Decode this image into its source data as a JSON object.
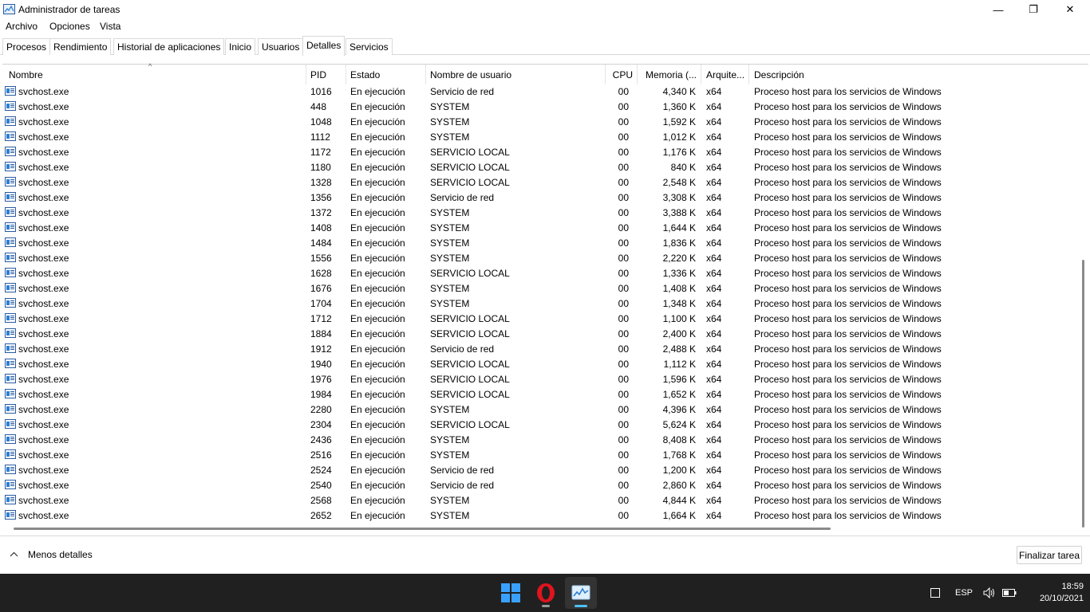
{
  "window": {
    "title": "Administrador de tareas",
    "minimize_glyph": "—",
    "maximize_glyph": "❐",
    "close_glyph": "✕"
  },
  "menu": [
    "Archivo",
    "Opciones",
    "Vista"
  ],
  "tabs": [
    {
      "label": "Procesos",
      "active": false
    },
    {
      "label": "Rendimiento",
      "active": false
    },
    {
      "label": "Historial de aplicaciones",
      "active": false
    },
    {
      "label": "Inicio",
      "active": false
    },
    {
      "label": "Usuarios",
      "active": false
    },
    {
      "label": "Detalles",
      "active": true
    },
    {
      "label": "Servicios",
      "active": false
    }
  ],
  "table": {
    "columns": [
      "Nombre",
      "PID",
      "Estado",
      "Nombre de usuario",
      "CPU",
      "Memoria (...",
      "Arquite...",
      "Descripción"
    ],
    "sort_indicator": "^",
    "rows": [
      [
        "svchost.exe",
        "1016",
        "En ejecución",
        "Servicio de red",
        "00",
        "4,340 K",
        "x64",
        "Proceso host para los servicios de Windows"
      ],
      [
        "svchost.exe",
        "448",
        "En ejecución",
        "SYSTEM",
        "00",
        "1,360 K",
        "x64",
        "Proceso host para los servicios de Windows"
      ],
      [
        "svchost.exe",
        "1048",
        "En ejecución",
        "SYSTEM",
        "00",
        "1,592 K",
        "x64",
        "Proceso host para los servicios de Windows"
      ],
      [
        "svchost.exe",
        "1112",
        "En ejecución",
        "SYSTEM",
        "00",
        "1,012 K",
        "x64",
        "Proceso host para los servicios de Windows"
      ],
      [
        "svchost.exe",
        "1172",
        "En ejecución",
        "SERVICIO LOCAL",
        "00",
        "1,176 K",
        "x64",
        "Proceso host para los servicios de Windows"
      ],
      [
        "svchost.exe",
        "1180",
        "En ejecución",
        "SERVICIO LOCAL",
        "00",
        "840 K",
        "x64",
        "Proceso host para los servicios de Windows"
      ],
      [
        "svchost.exe",
        "1328",
        "En ejecución",
        "SERVICIO LOCAL",
        "00",
        "2,548 K",
        "x64",
        "Proceso host para los servicios de Windows"
      ],
      [
        "svchost.exe",
        "1356",
        "En ejecución",
        "Servicio de red",
        "00",
        "3,308 K",
        "x64",
        "Proceso host para los servicios de Windows"
      ],
      [
        "svchost.exe",
        "1372",
        "En ejecución",
        "SYSTEM",
        "00",
        "3,388 K",
        "x64",
        "Proceso host para los servicios de Windows"
      ],
      [
        "svchost.exe",
        "1408",
        "En ejecución",
        "SYSTEM",
        "00",
        "1,644 K",
        "x64",
        "Proceso host para los servicios de Windows"
      ],
      [
        "svchost.exe",
        "1484",
        "En ejecución",
        "SYSTEM",
        "00",
        "1,836 K",
        "x64",
        "Proceso host para los servicios de Windows"
      ],
      [
        "svchost.exe",
        "1556",
        "En ejecución",
        "SYSTEM",
        "00",
        "2,220 K",
        "x64",
        "Proceso host para los servicios de Windows"
      ],
      [
        "svchost.exe",
        "1628",
        "En ejecución",
        "SERVICIO LOCAL",
        "00",
        "1,336 K",
        "x64",
        "Proceso host para los servicios de Windows"
      ],
      [
        "svchost.exe",
        "1676",
        "En ejecución",
        "SYSTEM",
        "00",
        "1,408 K",
        "x64",
        "Proceso host para los servicios de Windows"
      ],
      [
        "svchost.exe",
        "1704",
        "En ejecución",
        "SYSTEM",
        "00",
        "1,348 K",
        "x64",
        "Proceso host para los servicios de Windows"
      ],
      [
        "svchost.exe",
        "1712",
        "En ejecución",
        "SERVICIO LOCAL",
        "00",
        "1,100 K",
        "x64",
        "Proceso host para los servicios de Windows"
      ],
      [
        "svchost.exe",
        "1884",
        "En ejecución",
        "SERVICIO LOCAL",
        "00",
        "2,400 K",
        "x64",
        "Proceso host para los servicios de Windows"
      ],
      [
        "svchost.exe",
        "1912",
        "En ejecución",
        "Servicio de red",
        "00",
        "2,488 K",
        "x64",
        "Proceso host para los servicios de Windows"
      ],
      [
        "svchost.exe",
        "1940",
        "En ejecución",
        "SERVICIO LOCAL",
        "00",
        "1,112 K",
        "x64",
        "Proceso host para los servicios de Windows"
      ],
      [
        "svchost.exe",
        "1976",
        "En ejecución",
        "SERVICIO LOCAL",
        "00",
        "1,596 K",
        "x64",
        "Proceso host para los servicios de Windows"
      ],
      [
        "svchost.exe",
        "1984",
        "En ejecución",
        "SERVICIO LOCAL",
        "00",
        "1,652 K",
        "x64",
        "Proceso host para los servicios de Windows"
      ],
      [
        "svchost.exe",
        "2280",
        "En ejecución",
        "SYSTEM",
        "00",
        "4,396 K",
        "x64",
        "Proceso host para los servicios de Windows"
      ],
      [
        "svchost.exe",
        "2304",
        "En ejecución",
        "SERVICIO LOCAL",
        "00",
        "5,624 K",
        "x64",
        "Proceso host para los servicios de Windows"
      ],
      [
        "svchost.exe",
        "2436",
        "En ejecución",
        "SYSTEM",
        "00",
        "8,408 K",
        "x64",
        "Proceso host para los servicios de Windows"
      ],
      [
        "svchost.exe",
        "2516",
        "En ejecución",
        "SYSTEM",
        "00",
        "1,768 K",
        "x64",
        "Proceso host para los servicios de Windows"
      ],
      [
        "svchost.exe",
        "2524",
        "En ejecución",
        "Servicio de red",
        "00",
        "1,200 K",
        "x64",
        "Proceso host para los servicios de Windows"
      ],
      [
        "svchost.exe",
        "2540",
        "En ejecución",
        "Servicio de red",
        "00",
        "2,860 K",
        "x64",
        "Proceso host para los servicios de Windows"
      ],
      [
        "svchost.exe",
        "2568",
        "En ejecución",
        "SYSTEM",
        "00",
        "4,844 K",
        "x64",
        "Proceso host para los servicios de Windows"
      ],
      [
        "svchost.exe",
        "2652",
        "En ejecución",
        "SYSTEM",
        "00",
        "1,664 K",
        "x64",
        "Proceso host para los servicios de Windows"
      ]
    ]
  },
  "footer": {
    "fewer_details": "Menos detalles",
    "end_task": "Finalizar tarea"
  },
  "taskbar": {
    "apps": [
      "windows-start-icon",
      "opera-icon",
      "task-manager-icon"
    ],
    "language": "ESP",
    "time": "18:59",
    "date": "20/10/2021"
  },
  "colors": {
    "accent": "#4cc2ff",
    "taskbar_bg": "#202020",
    "opera_red": "#e0141e",
    "start_blue": "#0078d4"
  }
}
